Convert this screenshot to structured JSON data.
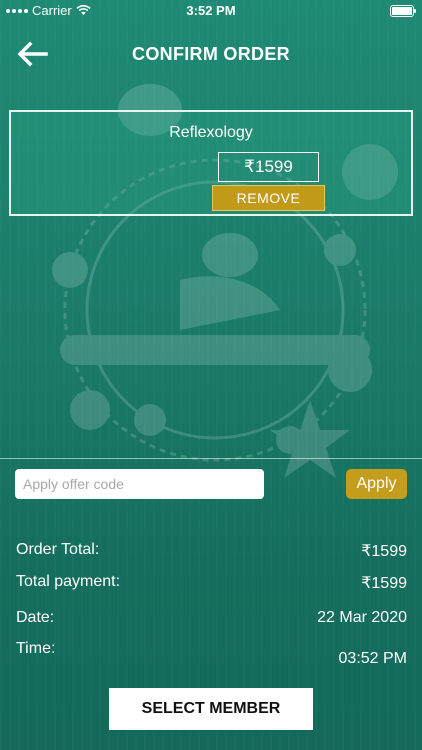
{
  "status_bar": {
    "carrier": "Carrier",
    "time": "3:52 PM"
  },
  "header": {
    "title": "CONFIRM ORDER"
  },
  "cart_item": {
    "name": "Reflexology",
    "price": "₹1599",
    "remove_label": "REMOVE"
  },
  "offer": {
    "placeholder": "Apply offer code",
    "apply_label": "Apply"
  },
  "summary": {
    "order_total_label": "Order Total:",
    "order_total_value": "₹1599",
    "total_payment_label": "Total payment:",
    "total_payment_value": "₹1599",
    "date_label": "Date:",
    "date_value": "22 Mar 2020",
    "time_label": "Time:",
    "time_value": "03:52 PM"
  },
  "footer": {
    "select_member_label": "SELECT MEMBER"
  },
  "colors": {
    "background": "#1a7a68",
    "accent": "#c59d1c"
  }
}
